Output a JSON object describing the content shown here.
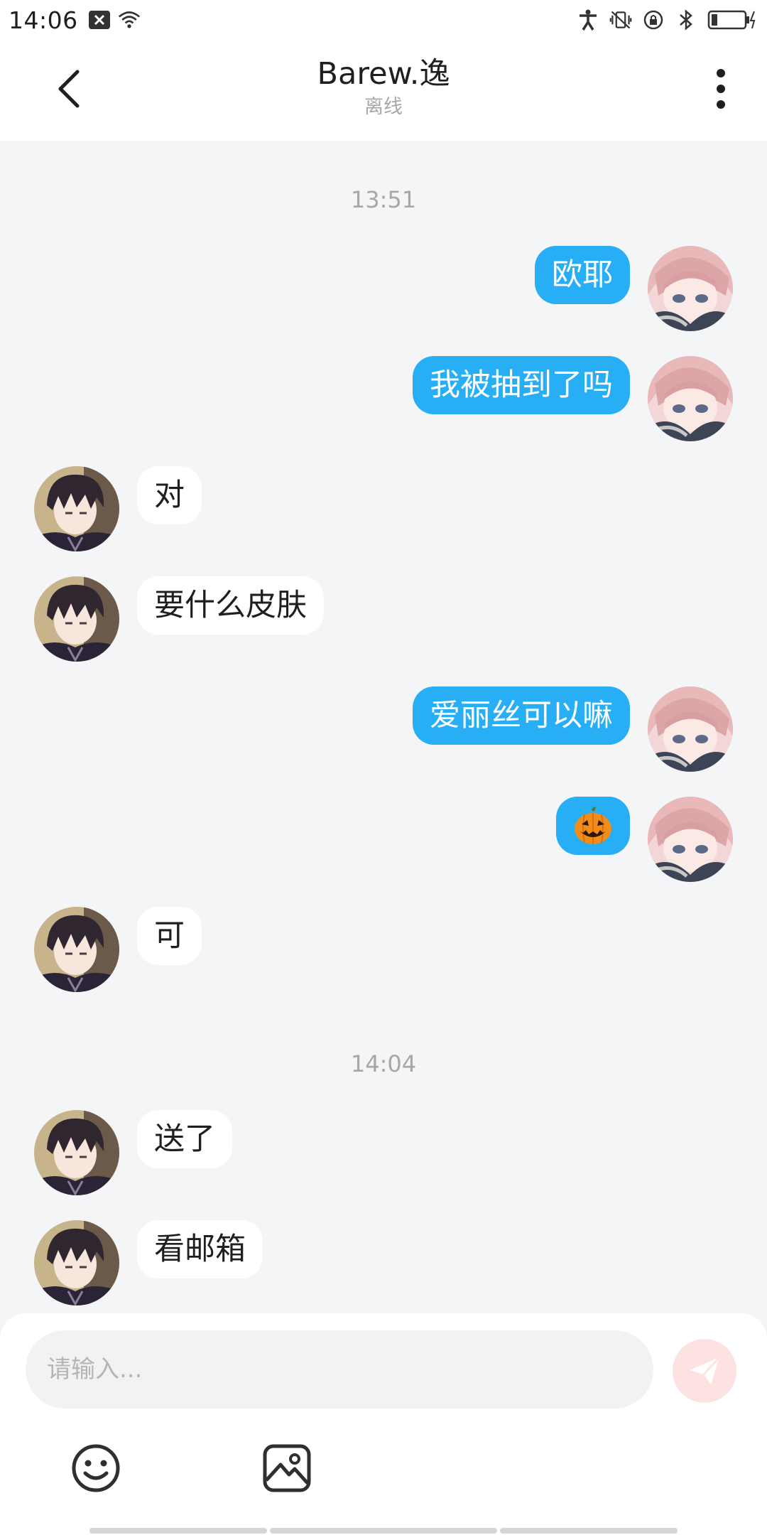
{
  "status_bar": {
    "time": "14:06"
  },
  "header": {
    "title": "Barew.逸",
    "subtitle": "离线"
  },
  "chat": {
    "timestamp_1": "13:51",
    "timestamp_2": "14:04",
    "messages": [
      {
        "side": "right",
        "text": "欧耶"
      },
      {
        "side": "right",
        "text": "我被抽到了吗"
      },
      {
        "side": "left",
        "text": "对"
      },
      {
        "side": "left",
        "text": "要什么皮肤"
      },
      {
        "side": "right",
        "text": "爱丽丝可以嘛"
      },
      {
        "side": "right",
        "text": "🎃",
        "emoji": "jack-o-lantern"
      },
      {
        "side": "left",
        "text": "可"
      },
      {
        "side": "left",
        "text": "送了"
      },
      {
        "side": "left",
        "text": "看邮箱"
      }
    ]
  },
  "composer": {
    "placeholder": "请输入...",
    "send_icon": "paper-plane-icon",
    "tools": [
      "emoji-icon",
      "image-icon"
    ]
  },
  "colors": {
    "accent": "#27aef5",
    "background": "#f4f5f7",
    "send_disabled": "#fde2e2"
  }
}
